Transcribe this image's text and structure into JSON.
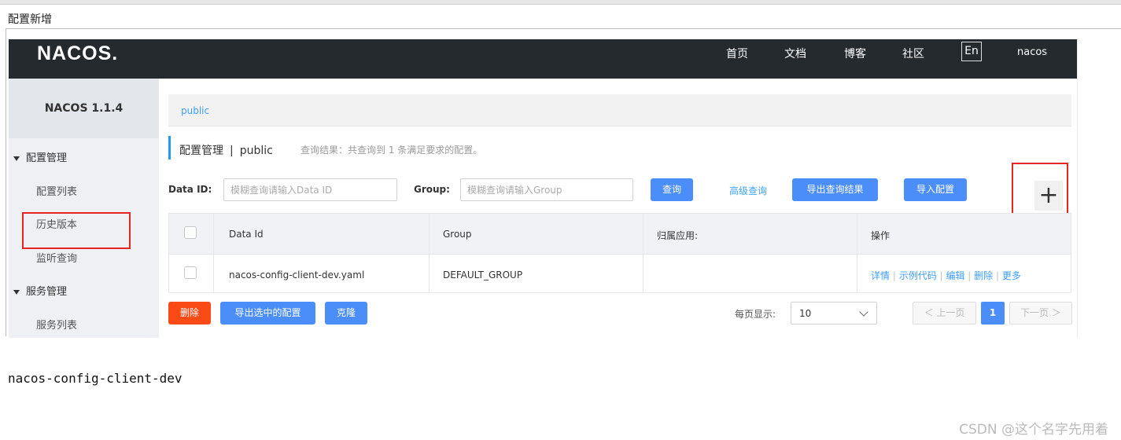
{
  "dialog": {
    "title": "配置新增"
  },
  "header": {
    "logo": "NACOS.",
    "nav": [
      "首页",
      "文档",
      "博客",
      "社区"
    ],
    "lang": "En",
    "user": "nacos"
  },
  "sidebar": {
    "version": "NACOS 1.1.4",
    "groups": [
      {
        "label": "配置管理",
        "items": [
          "配置列表",
          "历史版本",
          "监听查询"
        ]
      },
      {
        "label": "服务管理",
        "items": [
          "服务列表"
        ]
      }
    ]
  },
  "main": {
    "breadcrumb": "public",
    "title": "配置管理",
    "title_sep": "|",
    "namespace": "public",
    "query_result": "查询结果：共查询到 1 条满足要求的配置。",
    "search": {
      "data_id_label": "Data ID:",
      "data_id_placeholder": "模糊查询请输入Data ID",
      "group_label": "Group:",
      "group_placeholder": "模糊查询请输入Group",
      "query_button": "查询",
      "advanced_query": "高级查询",
      "export_results": "导出查询结果",
      "import_config": "导入配置",
      "add_symbol": "+"
    },
    "table": {
      "columns": [
        "Data Id",
        "Group",
        "归属应用:",
        "操作"
      ],
      "rows": [
        {
          "data_id": "nacos-config-client-dev.yaml",
          "group": "DEFAULT_GROUP",
          "app": "",
          "ops": [
            "详情",
            "示例代码",
            "编辑",
            "删除",
            "更多"
          ]
        }
      ],
      "ops_sep": "|"
    },
    "actions": {
      "delete": "删除",
      "export_selected": "导出选中的配置",
      "clone": "克隆"
    },
    "pagination": {
      "page_size_label": "每页显示:",
      "page_size": "10",
      "prev": "＜ 上一页",
      "current": "1",
      "next": "下一页 ＞"
    }
  },
  "below_text": "nacos-config-client-dev",
  "watermark": "CSDN @这个名字先用着",
  "colors": {
    "header_bg": "#252a2f",
    "primary": "#4b8efa",
    "danger": "#fa4b16",
    "link": "#3e9eff",
    "highlight_box": "#e52424"
  }
}
